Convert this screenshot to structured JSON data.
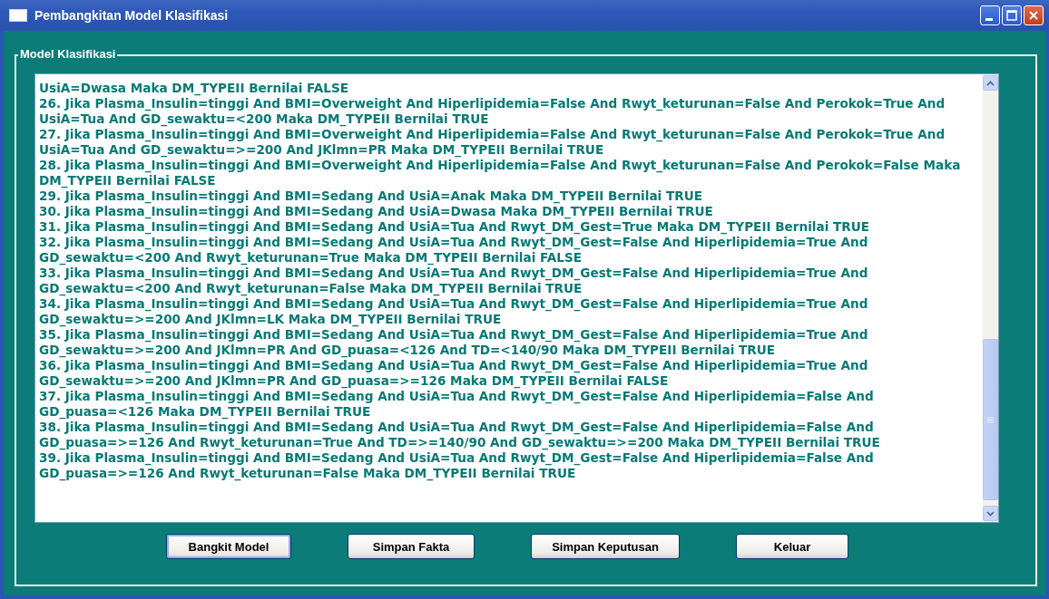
{
  "window": {
    "title": "Pembangkitan Model Klasifikasi"
  },
  "group": {
    "title": "Model Klasifikasi",
    "lines": [
      "UsiA=Dwasa Maka DM_TYPEII Bernilai FALSE",
      "26. Jika Plasma_Insulin=tinggi And BMI=Overweight And Hiperlipidemia=False And Rwyt_keturunan=False And Perokok=True And",
      "UsiA=Tua And GD_sewaktu=<200 Maka DM_TYPEII Bernilai TRUE",
      "27. Jika Plasma_Insulin=tinggi And BMI=Overweight And Hiperlipidemia=False And Rwyt_keturunan=False And Perokok=True And",
      "UsiA=Tua And GD_sewaktu=>=200 And JKlmn=PR Maka DM_TYPEII Bernilai TRUE",
      "28. Jika Plasma_Insulin=tinggi And BMI=Overweight And Hiperlipidemia=False And Rwyt_keturunan=False And Perokok=False Maka",
      "DM_TYPEII Bernilai FALSE",
      "29. Jika Plasma_Insulin=tinggi And BMI=Sedang And UsiA=Anak Maka DM_TYPEII Bernilai TRUE",
      "30. Jika Plasma_Insulin=tinggi And BMI=Sedang And UsiA=Dwasa Maka DM_TYPEII Bernilai TRUE",
      "31. Jika Plasma_Insulin=tinggi And BMI=Sedang And UsiA=Tua And Rwyt_DM_Gest=True Maka DM_TYPEII Bernilai TRUE",
      "32. Jika Plasma_Insulin=tinggi And BMI=Sedang And UsiA=Tua And Rwyt_DM_Gest=False And Hiperlipidemia=True And",
      "GD_sewaktu=<200 And Rwyt_keturunan=True Maka DM_TYPEII Bernilai FALSE",
      "33. Jika Plasma_Insulin=tinggi And BMI=Sedang And UsiA=Tua And Rwyt_DM_Gest=False And Hiperlipidemia=True And",
      "GD_sewaktu=<200 And Rwyt_keturunan=False Maka DM_TYPEII Bernilai TRUE",
      "34. Jika Plasma_Insulin=tinggi And BMI=Sedang And UsiA=Tua And Rwyt_DM_Gest=False And Hiperlipidemia=True And",
      "GD_sewaktu=>=200 And JKlmn=LK Maka DM_TYPEII Bernilai TRUE",
      "35. Jika Plasma_Insulin=tinggi And BMI=Sedang And UsiA=Tua And Rwyt_DM_Gest=False And Hiperlipidemia=True And",
      "GD_sewaktu=>=200 And JKlmn=PR And GD_puasa=<126 And TD=<140/90 Maka DM_TYPEII Bernilai TRUE",
      "36. Jika Plasma_Insulin=tinggi And BMI=Sedang And UsiA=Tua And Rwyt_DM_Gest=False And Hiperlipidemia=True And",
      "GD_sewaktu=>=200 And JKlmn=PR And GD_puasa=>=126 Maka DM_TYPEII Bernilai FALSE",
      "37. Jika Plasma_Insulin=tinggi And BMI=Sedang And UsiA=Tua And Rwyt_DM_Gest=False And Hiperlipidemia=False And",
      "GD_puasa=<126 Maka DM_TYPEII Bernilai TRUE",
      "38. Jika Plasma_Insulin=tinggi And BMI=Sedang And UsiA=Tua And Rwyt_DM_Gest=False And Hiperlipidemia=False And",
      "GD_puasa=>=126 And Rwyt_keturunan=True And TD=>=140/90 And GD_sewaktu=>=200 Maka DM_TYPEII Bernilai TRUE",
      "39. Jika Plasma_Insulin=tinggi And BMI=Sedang And UsiA=Tua And Rwyt_DM_Gest=False And Hiperlipidemia=False And",
      "GD_puasa=>=126 And Rwyt_keturunan=False Maka DM_TYPEII Bernilai TRUE"
    ]
  },
  "buttons": [
    {
      "label": "Bangkit Model",
      "focused": true
    },
    {
      "label": "Simpan Fakta",
      "focused": false
    },
    {
      "label": "Simpan Keputusan",
      "focused": false
    },
    {
      "label": "Keluar",
      "focused": false
    }
  ]
}
